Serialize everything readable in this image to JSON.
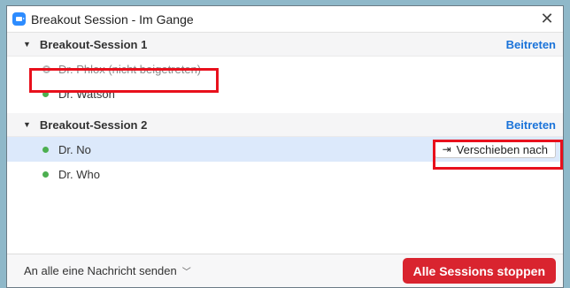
{
  "window": {
    "title": "Breakout Session - Im Gange"
  },
  "sessions": [
    {
      "name": "Breakout-Session 1",
      "join_label": "Beitreten",
      "participants": [
        {
          "name": "Dr. Phlox (nicht beigetreten)",
          "status": "not-joined"
        },
        {
          "name": "Dr. Watson",
          "status": "joined"
        }
      ]
    },
    {
      "name": "Breakout-Session 2",
      "join_label": "Beitreten",
      "participants": [
        {
          "name": "Dr. No",
          "status": "joined"
        },
        {
          "name": "Dr. Who",
          "status": "joined"
        }
      ]
    }
  ],
  "row_action": {
    "move_label": "Verschieben nach"
  },
  "footer": {
    "message_label": "An alle eine Nachricht senden",
    "stop_label": "Alle Sessions stoppen"
  },
  "colors": {
    "accent": "#1a73d9",
    "danger": "#d9242f",
    "online": "#4caf50",
    "highlight": "#e8101c"
  }
}
